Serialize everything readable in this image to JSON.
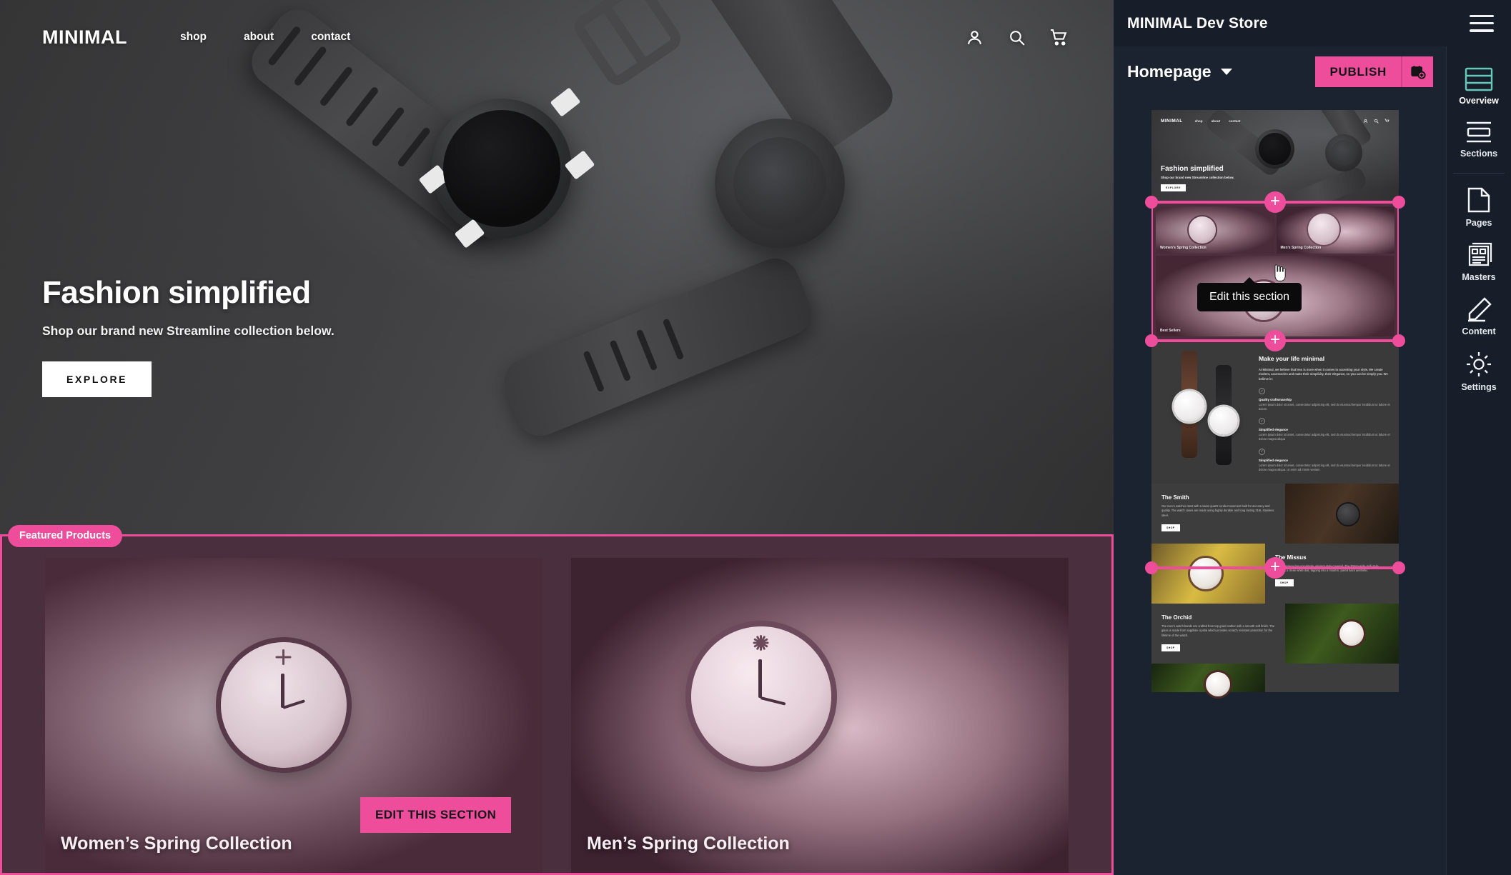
{
  "site": {
    "brand": "MINIMAL",
    "nav_links": [
      "shop",
      "about",
      "contact"
    ],
    "nav_icons": [
      "account-icon",
      "search-icon",
      "cart-icon"
    ],
    "hero": {
      "heading": "Fashion simplified",
      "subheading": "Shop our brand new Streamline collection below.",
      "cta": "EXPLORE"
    },
    "featured": {
      "badge": "Featured Products",
      "edit_button": "EDIT THIS SECTION",
      "cards": [
        {
          "label": "Women’s Spring Collection"
        },
        {
          "label": "Men’s Spring Collection"
        }
      ]
    }
  },
  "builder": {
    "app_title": "MINIMAL Dev Store",
    "menu_icon": "hamburger-icon",
    "page_selector": "Homepage",
    "page_selector_icon": "chevron-down-icon",
    "publish_label": "PUBLISH",
    "publish_schedule_icon": "calendar-add-icon",
    "accent_color": "#ee4d9b",
    "panel_color": "#1b2330",
    "tooltip": "Edit this section",
    "add_section_icon": "plus-icon",
    "rail": [
      {
        "label": "Overview",
        "icon": "rows-overview-icon",
        "active": true
      },
      {
        "label": "Sections",
        "icon": "sections-icon",
        "active": false
      },
      {
        "label": "Pages",
        "icon": "page-icon",
        "active": false
      },
      {
        "label": "Masters",
        "icon": "masters-icon",
        "active": false
      },
      {
        "label": "Content",
        "icon": "pencil-icon",
        "active": false
      },
      {
        "label": "Settings",
        "icon": "gear-icon",
        "active": false
      }
    ],
    "preview": {
      "hero": {
        "brand": "MINIMAL",
        "links": [
          "shop",
          "about",
          "contact"
        ],
        "heading": "Fashion simplified",
        "subheading": "Shop our brand new Streamline collection below.",
        "cta": "EXPLORE"
      },
      "featured": {
        "women_label": "Women’s Spring Collection",
        "men_label": "Men’s Spring Collection",
        "best_label": "Best Sellers"
      },
      "about": {
        "heading": "Make your life minimal",
        "intro": "At Minimal, we believe that less is more when it comes to accenting your style. We create modern, accessories and make their simplicity, their elegance, so you can be simply you. We believe in:",
        "features": [
          {
            "title": "Quality craftsmanship",
            "body": "Lorem ipsum dolor sit amet, consectetur adipiscing elit, sed do eiusmod tempor incididunt ut labore et dolore."
          },
          {
            "title": "Simplified elegance",
            "body": "Lorem ipsum dolor sit amet, consectetur adipiscing elit, sed do eiusmod tempor incididunt ut labore et dolore magna aliqua"
          },
          {
            "title": "Simplified elegance",
            "body": "Lorem ipsum dolor sit amet, consectetur adipiscing elit, sed do eiusmod tempor incididunt ut labore et dolore magna aliqua. Ut enim ad minim veniam"
          }
        ]
      },
      "products": [
        {
          "title": "The Smith",
          "body": "Our men’s watches start with a swiss quartz ronda movement built for accuracy and quality. The watch cases are made using highly durable and long lasting 316L stainless steel.",
          "cta": "SHOP"
        },
        {
          "title": "The Missus",
          "body": "This timepiece has got simple, elegant style covered. The 30mm-wide midi style features a clean white dial, tapping into a modern, pared back aesthetic.",
          "cta": "SHOP"
        },
        {
          "title": "The Orchid",
          "body": "The men’s watch bands are crafted from top grain leather with a smooth soft finish. The glass is made from sapphire crystal which provides scratch resistant protection for the lifetime of the watch.",
          "cta": "SHOP"
        }
      ]
    }
  }
}
